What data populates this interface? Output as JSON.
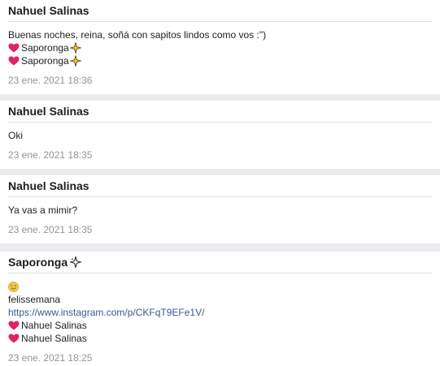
{
  "messages": [
    {
      "sender": "Nahuel Salinas",
      "text": "Buenas noches, reina, soñá con sapitos lindos como vos :\")",
      "reactions": [
        "Saporonga",
        "Saporonga"
      ],
      "timestamp": "23 ene. 2021 18:36"
    },
    {
      "sender": "Nahuel Salinas",
      "text": "Oki",
      "timestamp": "23 ene. 2021 18:35"
    },
    {
      "sender": "Nahuel Salinas",
      "text": "Ya vas a mimir?",
      "timestamp": "23 ene. 2021 18:35"
    },
    {
      "sender": "Saporonga",
      "line1": "felissemana",
      "link": "https://www.instagram.com/p/CKFqT9EFe1V/",
      "reactions": [
        "Nahuel Salinas",
        "Nahuel Salinas"
      ],
      "timestamp": "23 ene. 2021 18:25"
    }
  ],
  "colors": {
    "background": "#e9ebee",
    "card": "#ffffff",
    "divider": "#dddfe2",
    "timestamp": "#90949c",
    "link": "#385898",
    "heart": "#e0245e"
  },
  "icons": {
    "reaction": "red-heart-icon",
    "sparkle": "sparkle-icon",
    "emoji": "smiling-face-icon"
  }
}
